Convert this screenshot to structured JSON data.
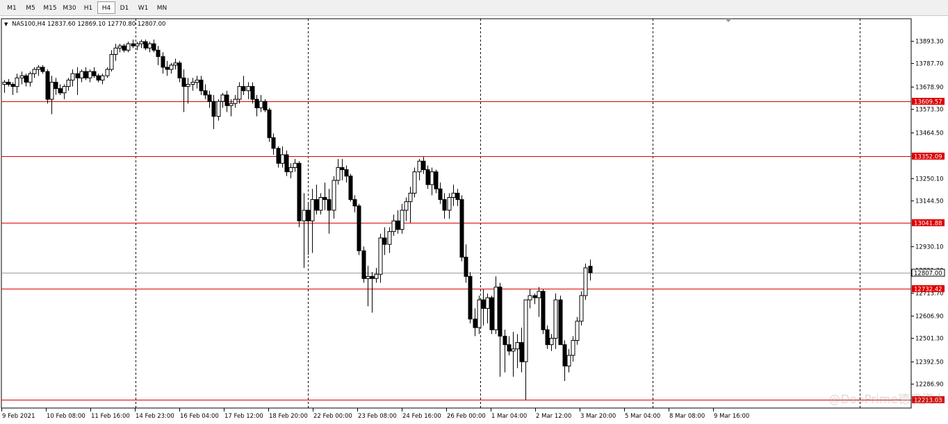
{
  "toolbar": {
    "timeframes": [
      {
        "label": "M1"
      },
      {
        "label": "M5"
      },
      {
        "label": "M15"
      },
      {
        "label": "M30"
      },
      {
        "label": "H1"
      },
      {
        "label": "H4",
        "active": true
      },
      {
        "label": "D1"
      },
      {
        "label": "W1"
      },
      {
        "label": "MN"
      }
    ]
  },
  "chart_info": {
    "symbol": "NAS100,H4",
    "ohlc": "12837.60 12869.10 12770.80 12807.00"
  },
  "watermark": "@DooPrime德璞资本",
  "colors": {
    "resistance_line": "#dd0000",
    "price_line": "#9a9a9a",
    "candle": "#000000"
  },
  "chart_data": {
    "type": "candlestick",
    "y_ticks": [
      "13893.30",
      "13787.70",
      "13678.90",
      "13573.30",
      "13464.50",
      "13250.10",
      "13144.50",
      "12930.10",
      "12821.30",
      "12713.70",
      "12606.90",
      "12501.30",
      "12392.50",
      "12286.90"
    ],
    "x_ticks": [
      "9 Feb 2021",
      "10 Feb 08:00",
      "11 Feb 16:00",
      "14 Feb 23:00",
      "16 Feb 04:00",
      "17 Feb 12:00",
      "18 Feb 20:00",
      "22 Feb 00:00",
      "23 Feb 08:00",
      "24 Feb 16:00",
      "26 Feb 00:00",
      "1 Mar 04:00",
      "2 Mar 12:00",
      "3 Mar 20:00",
      "5 Mar 04:00",
      "8 Mar 08:00",
      "9 Mar 16:00"
    ],
    "current_price": "12807.00",
    "horizontal_lines": [
      {
        "label": "13609.57",
        "value": 13609.57
      },
      {
        "label": "13352.09",
        "value": 13352.09
      },
      {
        "label": "13041.88",
        "value": 13041.88
      },
      {
        "label": "12732.42",
        "value": 12732.42
      },
      {
        "label": "12213.03",
        "value": 12213.03
      }
    ],
    "candles": [
      [
        13690,
        13710,
        13650,
        13700
      ],
      [
        13700,
        13715,
        13680,
        13690
      ],
      [
        13690,
        13700,
        13640,
        13680
      ],
      [
        13680,
        13740,
        13650,
        13720
      ],
      [
        13720,
        13750,
        13690,
        13730
      ],
      [
        13730,
        13740,
        13680,
        13700
      ],
      [
        13700,
        13750,
        13680,
        13740
      ],
      [
        13740,
        13770,
        13720,
        13760
      ],
      [
        13760,
        13780,
        13730,
        13770
      ],
      [
        13770,
        13780,
        13740,
        13750
      ],
      [
        13750,
        13760,
        13600,
        13620
      ],
      [
        13620,
        13730,
        13550,
        13700
      ],
      [
        13700,
        13720,
        13640,
        13670
      ],
      [
        13670,
        13690,
        13640,
        13650
      ],
      [
        13650,
        13690,
        13620,
        13680
      ],
      [
        13680,
        13720,
        13660,
        13710
      ],
      [
        13710,
        13760,
        13680,
        13740
      ],
      [
        13740,
        13770,
        13640,
        13720
      ],
      [
        13720,
        13760,
        13700,
        13750
      ],
      [
        13750,
        13770,
        13710,
        13720
      ],
      [
        13720,
        13760,
        13700,
        13750
      ],
      [
        13750,
        13770,
        13720,
        13730
      ],
      [
        13730,
        13740,
        13700,
        13710
      ],
      [
        13710,
        13740,
        13690,
        13730
      ],
      [
        13730,
        13770,
        13720,
        13760
      ],
      [
        13760,
        13850,
        13750,
        13830
      ],
      [
        13830,
        13880,
        13800,
        13860
      ],
      [
        13860,
        13880,
        13840,
        13870
      ],
      [
        13870,
        13880,
        13840,
        13850
      ],
      [
        13850,
        13890,
        13840,
        13880
      ],
      [
        13880,
        13900,
        13860,
        13870
      ],
      [
        13870,
        13890,
        13850,
        13880
      ],
      [
        13880,
        13900,
        13860,
        13890
      ],
      [
        13890,
        13900,
        13850,
        13860
      ],
      [
        13860,
        13890,
        13840,
        13880
      ],
      [
        13880,
        13900,
        13840,
        13850
      ],
      [
        13850,
        13870,
        13780,
        13820
      ],
      [
        13820,
        13840,
        13740,
        13770
      ],
      [
        13770,
        13800,
        13730,
        13760
      ],
      [
        13760,
        13790,
        13740,
        13780
      ],
      [
        13780,
        13810,
        13760,
        13790
      ],
      [
        13790,
        13800,
        13700,
        13720
      ],
      [
        13720,
        13760,
        13560,
        13680
      ],
      [
        13680,
        13720,
        13600,
        13690
      ],
      [
        13690,
        13720,
        13660,
        13700
      ],
      [
        13700,
        13730,
        13670,
        13710
      ],
      [
        13710,
        13730,
        13640,
        13660
      ],
      [
        13660,
        13690,
        13620,
        13640
      ],
      [
        13640,
        13660,
        13580,
        13610
      ],
      [
        13610,
        13640,
        13480,
        13540
      ],
      [
        13540,
        13620,
        13520,
        13610
      ],
      [
        13610,
        13650,
        13580,
        13640
      ],
      [
        13640,
        13660,
        13560,
        13590
      ],
      [
        13590,
        13620,
        13540,
        13600
      ],
      [
        13600,
        13640,
        13580,
        13620
      ],
      [
        13620,
        13700,
        13600,
        13680
      ],
      [
        13680,
        13730,
        13640,
        13660
      ],
      [
        13660,
        13700,
        13620,
        13680
      ],
      [
        13680,
        13700,
        13600,
        13620
      ],
      [
        13620,
        13640,
        13540,
        13580
      ],
      [
        13580,
        13640,
        13560,
        13610
      ],
      [
        13610,
        13620,
        13560,
        13570
      ],
      [
        13570,
        13580,
        13420,
        13440
      ],
      [
        13440,
        13460,
        13360,
        13390
      ],
      [
        13390,
        13400,
        13300,
        13320
      ],
      [
        13320,
        13400,
        13300,
        13360
      ],
      [
        13360,
        13380,
        13260,
        13280
      ],
      [
        13280,
        13320,
        13250,
        13300
      ],
      [
        13300,
        13340,
        13280,
        13320
      ],
      [
        13320,
        13330,
        13020,
        13050
      ],
      [
        13050,
        13180,
        12830,
        13100
      ],
      [
        13100,
        13130,
        12890,
        13050
      ],
      [
        13050,
        13200,
        12900,
        13150
      ],
      [
        13150,
        13220,
        13080,
        13100
      ],
      [
        13100,
        13180,
        13080,
        13160
      ],
      [
        13160,
        13230,
        13100,
        13150
      ],
      [
        13150,
        13200,
        12990,
        13100
      ],
      [
        13100,
        13260,
        13060,
        13240
      ],
      [
        13240,
        13340,
        13220,
        13300
      ],
      [
        13300,
        13340,
        13240,
        13290
      ],
      [
        13290,
        13310,
        13230,
        13260
      ],
      [
        13260,
        13270,
        13140,
        13150
      ],
      [
        13150,
        13170,
        13090,
        13120
      ],
      [
        13120,
        13130,
        12890,
        12910
      ],
      [
        12910,
        12930,
        12760,
        12780
      ],
      [
        12780,
        12840,
        12650,
        12790
      ],
      [
        12790,
        12810,
        12620,
        12780
      ],
      [
        12780,
        12830,
        12760,
        12800
      ],
      [
        12800,
        12990,
        12760,
        12970
      ],
      [
        12970,
        13020,
        12890,
        12940
      ],
      [
        12940,
        13020,
        12900,
        13000
      ],
      [
        13000,
        13080,
        12980,
        13050
      ],
      [
        13050,
        13100,
        12990,
        13010
      ],
      [
        13010,
        13130,
        12990,
        13100
      ],
      [
        13100,
        13160,
        13050,
        13140
      ],
      [
        13140,
        13210,
        13040,
        13180
      ],
      [
        13180,
        13300,
        13160,
        13280
      ],
      [
        13280,
        13340,
        13240,
        13330
      ],
      [
        13330,
        13350,
        13270,
        13290
      ],
      [
        13290,
        13310,
        13200,
        13220
      ],
      [
        13220,
        13300,
        13170,
        13280
      ],
      [
        13280,
        13290,
        13180,
        13200
      ],
      [
        13200,
        13230,
        13130,
        13150
      ],
      [
        13150,
        13180,
        13060,
        13100
      ],
      [
        13100,
        13180,
        13060,
        13160
      ],
      [
        13160,
        13220,
        13120,
        13180
      ],
      [
        13180,
        13200,
        13120,
        13150
      ],
      [
        13150,
        13170,
        12860,
        12880
      ],
      [
        12880,
        12940,
        12760,
        12790
      ],
      [
        12790,
        12810,
        12570,
        12590
      ],
      [
        12590,
        12640,
        12510,
        12550
      ],
      [
        12550,
        12700,
        12520,
        12680
      ],
      [
        12680,
        12730,
        12560,
        12640
      ],
      [
        12640,
        12710,
        12570,
        12690
      ],
      [
        12690,
        12700,
        12520,
        12540
      ],
      [
        12540,
        12790,
        12520,
        12740
      ],
      [
        12740,
        12760,
        12320,
        12510
      ],
      [
        12510,
        12540,
        12340,
        12470
      ],
      [
        12470,
        12510,
        12420,
        12440
      ],
      [
        12440,
        12530,
        12320,
        12450
      ],
      [
        12450,
        12520,
        12360,
        12480
      ],
      [
        12480,
        12550,
        12340,
        12390
      ],
      [
        12390,
        12680,
        12210,
        12680
      ],
      [
        12680,
        12730,
        12640,
        12700
      ],
      [
        12700,
        12710,
        12660,
        12690
      ],
      [
        12690,
        12740,
        12600,
        12720
      ],
      [
        12720,
        12730,
        12520,
        12540
      ],
      [
        12540,
        12560,
        12450,
        12470
      ],
      [
        12470,
        12520,
        12440,
        12500
      ],
      [
        12500,
        12710,
        12450,
        12680
      ],
      [
        12680,
        12700,
        12510,
        12470
      ],
      [
        12470,
        12490,
        12300,
        12370
      ],
      [
        12370,
        12450,
        12340,
        12420
      ],
      [
        12420,
        12510,
        12390,
        12490
      ],
      [
        12490,
        12600,
        12470,
        12580
      ],
      [
        12580,
        12720,
        12560,
        12700
      ],
      [
        12700,
        12850,
        12680,
        12830
      ],
      [
        12837.6,
        12869.1,
        12770.8,
        12807
      ]
    ]
  }
}
